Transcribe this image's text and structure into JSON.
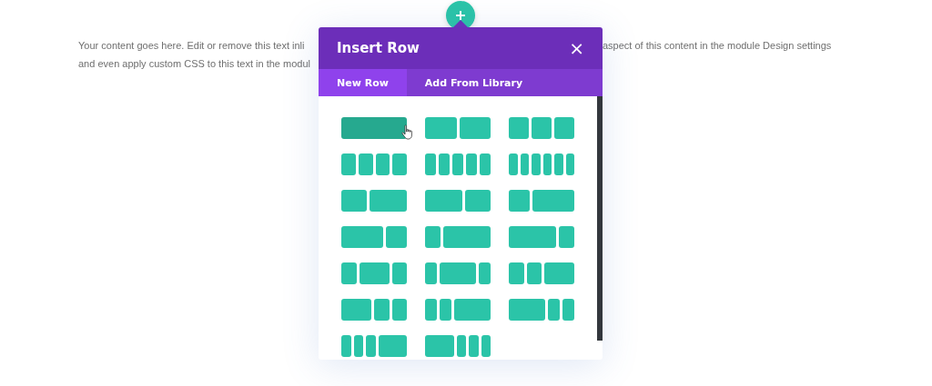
{
  "content_text": {
    "left_lines": [
      "Your content goes here. Edit or remove this text inli",
      "and even apply custom CSS to this text in the modul"
    ],
    "right_lines": [
      "aspect of this content in the module Design settings"
    ]
  },
  "modal": {
    "title": "Insert Row",
    "close": "×",
    "tabs": [
      {
        "label": "New Row",
        "selected": true
      },
      {
        "label": "Add From Library",
        "selected": false
      }
    ],
    "layouts": [
      {
        "kind": "full",
        "hovered": true
      },
      {
        "kind": "halves",
        "hovered": false
      },
      {
        "kind": "thirds",
        "hovered": false
      },
      {
        "kind": "quarters",
        "hovered": false
      },
      {
        "kind": "fifths",
        "hovered": false
      },
      {
        "kind": "sixths",
        "hovered": false
      },
      {
        "kind": "two-fifths-three-fifths",
        "hovered": false
      },
      {
        "kind": "three-fifths-two-fifths",
        "hovered": false
      },
      {
        "kind": "third-two-thirds",
        "hovered": false
      },
      {
        "kind": "two-thirds-third",
        "hovered": false
      },
      {
        "kind": "quarter-three-quarters",
        "hovered": false
      },
      {
        "kind": "three-quarters-quarter",
        "hovered": false
      },
      {
        "kind": "quarter-half-quarter",
        "hovered": false
      },
      {
        "kind": "fifth-three-fifths-fifth",
        "hovered": false
      },
      {
        "kind": "quarter-quarter-half",
        "hovered": false
      },
      {
        "kind": "half-quarter-quarter",
        "hovered": false
      },
      {
        "kind": "fifth-fifth-three-fifths",
        "hovered": false
      },
      {
        "kind": "three-fifths-fifth-fifth",
        "hovered": false
      },
      {
        "kind": "sixth-sixth-sixth-half",
        "hovered": false
      },
      {
        "kind": "half-sixth-sixth-sixth",
        "hovered": false
      }
    ]
  }
}
